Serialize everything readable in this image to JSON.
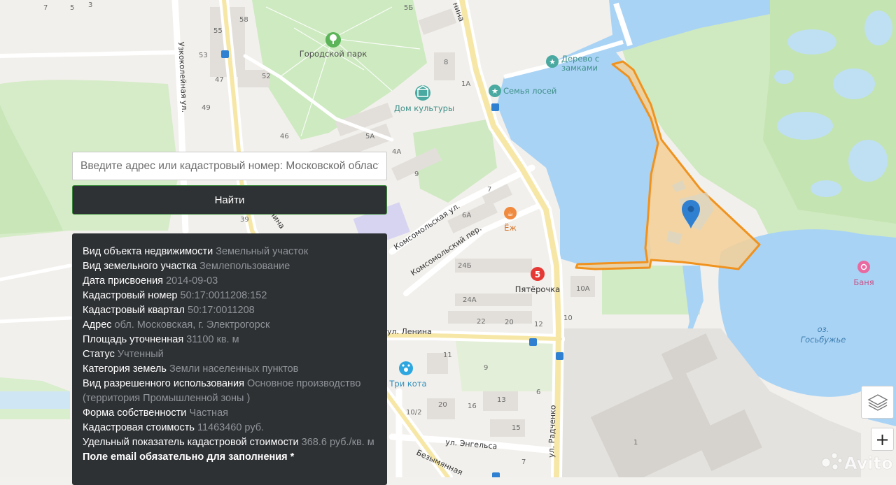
{
  "search": {
    "placeholder": "Введите адрес или кадастровый номер: Московской области",
    "button_label": "Найти"
  },
  "info": {
    "rows": [
      {
        "label": "Вид объекта недвижимости",
        "value": "Земельный участок"
      },
      {
        "label": "Вид земельного участка",
        "value": "Землепользование"
      },
      {
        "label": "Дата присвоения",
        "value": "2014-09-03"
      },
      {
        "label": "Кадастровый номер",
        "value": "50:17:0011208:152"
      },
      {
        "label": "Кадастровый квартал",
        "value": "50:17:0011208"
      },
      {
        "label": "Адрес",
        "value": "обл. Московская, г. Электрогорск"
      },
      {
        "label": "Площадь уточненная",
        "value": "31100 кв. м"
      },
      {
        "label": "Статус",
        "value": "Учтенный"
      },
      {
        "label": "Категория земель",
        "value": "Земли населенных пунктов"
      },
      {
        "label": "Вид разрешенного использования",
        "value": "Основное производство (территория Промышленной зоны )"
      },
      {
        "label": "Форма собственности",
        "value": "Частная"
      },
      {
        "label": "Кадастровая стоимость",
        "value": "11463460 руб."
      },
      {
        "label": "Удельный показатель кадастровой стоимости",
        "value": "368.6 руб./кв. м"
      }
    ],
    "email_note": "Поле email обязательно для заполнения *"
  },
  "map": {
    "pois": {
      "park": "Городской парк",
      "culture_house": "Дом культуры",
      "tree": "Дерево с замками",
      "moose": "Семья лосей",
      "cafe": "Ёж",
      "shop": "Пятёрочка",
      "pet": "Три кота",
      "bath": "Баня"
    },
    "lake_label": [
      "оз.",
      "Госьбужье"
    ],
    "streets": {
      "lenina_top": "Ленина",
      "lenina": "ул. Ленина",
      "komsomolskaya": "Комсомольская ул.",
      "komsomolsky": "Комсомольский пер.",
      "uzkokoleynaya": "Узкоколейная ул.",
      "radchenko": "ул. Радченко",
      "engelsa": "ул. Энгельса",
      "bezymyannaya": "Безымянная",
      "nina": "нина"
    },
    "house_numbers": {
      "n7": "7",
      "n5": "5",
      "n3": "3",
      "n58": "58",
      "n55": "55",
      "n53": "53",
      "n47": "47",
      "n52": "52",
      "n49": "49",
      "n46": "46",
      "n5b": "5Б",
      "n8": "8",
      "n1a": "1А",
      "n5a": "5А",
      "n4a": "4А",
      "n9": "9",
      "n7b": "7",
      "n6a": "6А",
      "n39": "39",
      "n24b": "24Б",
      "n10a": "10А",
      "n24a": "24А",
      "n22": "22",
      "n20": "20",
      "n12": "12",
      "n10": "10",
      "n11": "11",
      "n9b": "9",
      "n6": "6",
      "n20b": "20",
      "n16": "16",
      "n13": "13",
      "n10_2": "10/2",
      "n15": "15",
      "n7c": "7",
      "n1": "1"
    },
    "colors": {
      "water": "#a9d3f5",
      "green": "#cdeac0",
      "parcel_stroke": "#f0921e",
      "parcel_fill": "#f4cf96",
      "marker": "#2f80d1"
    }
  },
  "controls": {
    "zoom_in": "+"
  },
  "watermark": "Avito"
}
